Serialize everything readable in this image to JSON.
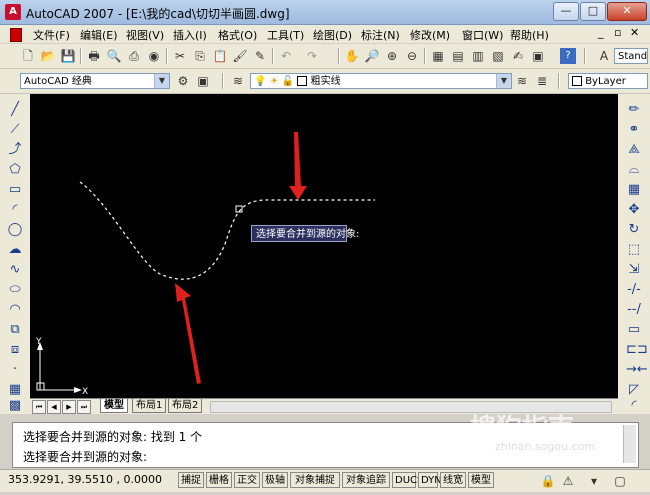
{
  "window": {
    "title": "AutoCAD 2007 - [E:\\我的cad\\切切半画圆.dwg]",
    "minimize": "—",
    "maximize": "□",
    "close": "✕"
  },
  "menu": [
    "文件(F)",
    "编辑(E)",
    "视图(V)",
    "插入(I)",
    "格式(O)",
    "工具(T)",
    "绘图(D)",
    "标注(N)",
    "修改(M)",
    "窗口(W)",
    "帮助(H)"
  ],
  "toolbar2": {
    "workspace": "AutoCAD 经典",
    "layer": "粗实线",
    "color": "ByLayer"
  },
  "toolbar1": {
    "textstyle": "Stand"
  },
  "drawing": {
    "tooltip": "选择要合并到源的对象:",
    "ucs_y": "Y",
    "ucs_x": "X"
  },
  "tabs": {
    "model": "模型",
    "layout1": "布局1",
    "layout2": "布局2"
  },
  "command": {
    "line1": "选择要合并到源的对象:  找到 1 个",
    "line2": "选择要合并到源的对象:"
  },
  "status": {
    "coords": "353.9291, 39.5510 , 0.0000",
    "buttons": [
      "捕捉",
      "栅格",
      "正交",
      "极轴",
      "对象捕捉",
      "对象追踪",
      "DUCS",
      "DYN",
      "线宽",
      "模型"
    ]
  },
  "watermark": {
    "brand": "搜狗指南",
    "url": "zhinan.sogou.com"
  }
}
